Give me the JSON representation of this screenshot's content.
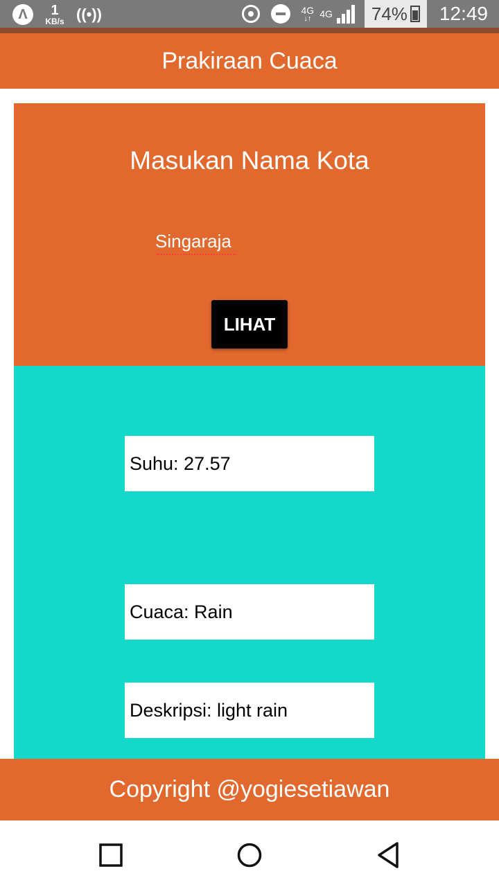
{
  "status_bar": {
    "speed_value": "1",
    "speed_unit": "KB/s",
    "network_4g_a": "4G",
    "network_arrows": "↓↑",
    "network_4g_b": "4G",
    "battery": "74%",
    "time": "12:49"
  },
  "header": {
    "title": "Prakiraan Cuaca"
  },
  "input_section": {
    "title": "Masukan Nama Kota",
    "city_value": "Singaraja",
    "button_label": "LIHAT"
  },
  "results": {
    "suhu": "Suhu: 27.57",
    "cuaca": "Cuaca: Rain",
    "deskripsi": "Deskripsi: light rain"
  },
  "footer": {
    "text": "Copyright @yogiesetiawan"
  },
  "colors": {
    "primary": "#e2692d",
    "result_bg": "#14d8ca",
    "button": "#000000"
  },
  "icons": {
    "status": [
      "app-a-icon",
      "hotspot-icon",
      "nfc-icon",
      "dnd-icon",
      "signal-icon",
      "battery-icon"
    ],
    "nav": [
      "recents-icon",
      "home-icon",
      "back-icon"
    ]
  }
}
